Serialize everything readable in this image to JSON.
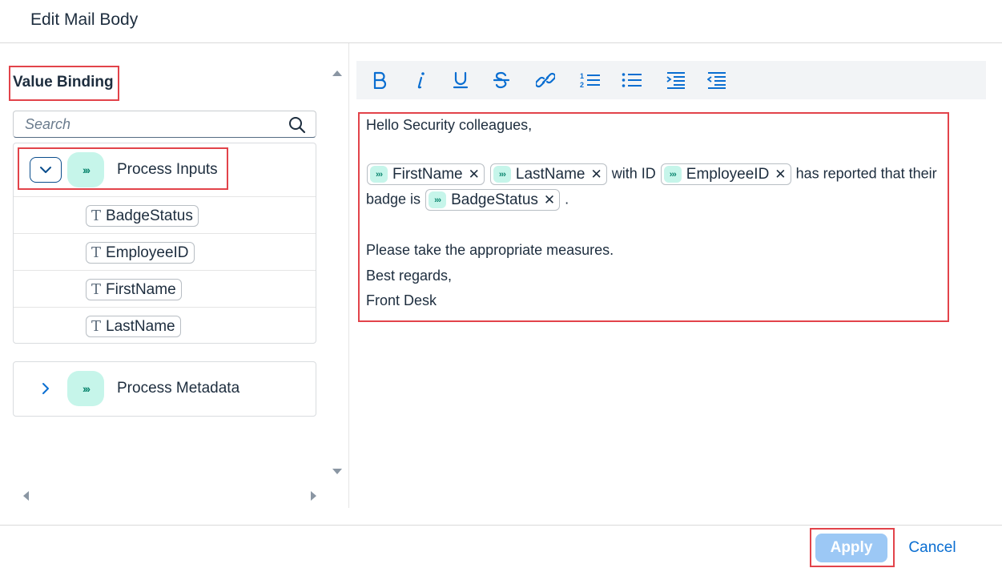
{
  "dialog": {
    "title": "Edit Mail Body"
  },
  "value_binding": {
    "title": "Value Binding",
    "search_placeholder": "Search",
    "groups": [
      {
        "label": "Process Inputs",
        "expanded": true,
        "badge_icon": "triple-chevron-icon",
        "fields": [
          {
            "type_icon": "T",
            "label": "BadgeStatus"
          },
          {
            "type_icon": "T",
            "label": "EmployeeID"
          },
          {
            "type_icon": "T",
            "label": "FirstName"
          },
          {
            "type_icon": "T",
            "label": "LastName"
          }
        ]
      },
      {
        "label": "Process Metadata",
        "expanded": false,
        "badge_icon": "triple-chevron-icon"
      }
    ]
  },
  "toolbar": {
    "buttons": [
      "bold-icon",
      "italic-icon",
      "underline-icon",
      "strikethrough-icon",
      "link-icon",
      "numbered-list-icon",
      "bullet-list-icon",
      "indent-icon",
      "outdent-icon"
    ]
  },
  "editor": {
    "greeting": "Hello Security colleagues,",
    "chip_firstname": "FirstName",
    "chip_lastname": "LastName",
    "text_with_id": "with ID",
    "chip_employeeid": "EmployeeID",
    "text_reported": "has reported that their",
    "text_badge_is": "badge is",
    "chip_badgestatus": "BadgeStatus",
    "text_period": ".",
    "line_measures": "Please take the appropriate measures.",
    "line_regards": "Best regards,",
    "line_signature": "Front Desk"
  },
  "footer": {
    "apply_label": "Apply",
    "cancel_label": "Cancel"
  },
  "colors": {
    "accent": "#0a6ed1",
    "highlight": "#e2434a",
    "badge_bg": "#c6f5ea",
    "apply_disabled": "#9cc8f5"
  }
}
